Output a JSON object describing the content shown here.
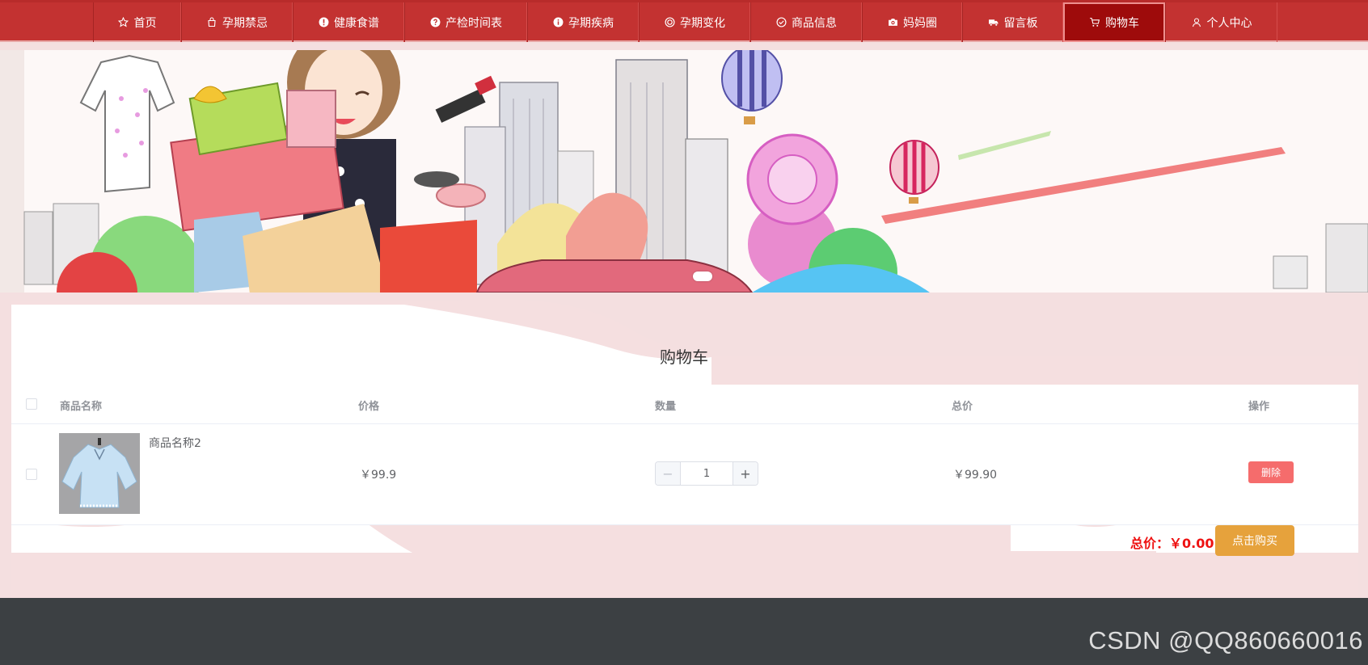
{
  "nav": {
    "items": [
      {
        "label": "首页",
        "icon": "star-icon"
      },
      {
        "label": "孕期禁忌",
        "icon": "bag-icon"
      },
      {
        "label": "健康食谱",
        "icon": "warning-icon"
      },
      {
        "label": "产检时间表",
        "icon": "question-icon"
      },
      {
        "label": "孕期疾病",
        "icon": "info-icon"
      },
      {
        "label": "孕期变化",
        "icon": "target-icon"
      },
      {
        "label": "商品信息",
        "icon": "check-circle-icon"
      },
      {
        "label": "妈妈圈",
        "icon": "camera-icon"
      },
      {
        "label": "留言板",
        "icon": "truck-icon"
      },
      {
        "label": "购物车",
        "icon": "cart-icon",
        "active": true
      },
      {
        "label": "个人中心",
        "icon": "user-icon"
      }
    ],
    "active_color": "#9e0b0b",
    "bg_color": "#c33231"
  },
  "cart": {
    "title": "购物车",
    "columns": {
      "name": "商品名称",
      "price": "价格",
      "quantity": "数量",
      "subtotal": "总价",
      "action": "操作"
    },
    "rows": [
      {
        "name": "商品名称2",
        "price": "￥99.9",
        "quantity": "1",
        "subtotal": "￥99.90",
        "delete_label": "删除"
      }
    ],
    "total_label": "总价：",
    "total_value": "￥0.00",
    "buy_label": "点击购买"
  },
  "watermark": "CSDN @QQ860660016"
}
